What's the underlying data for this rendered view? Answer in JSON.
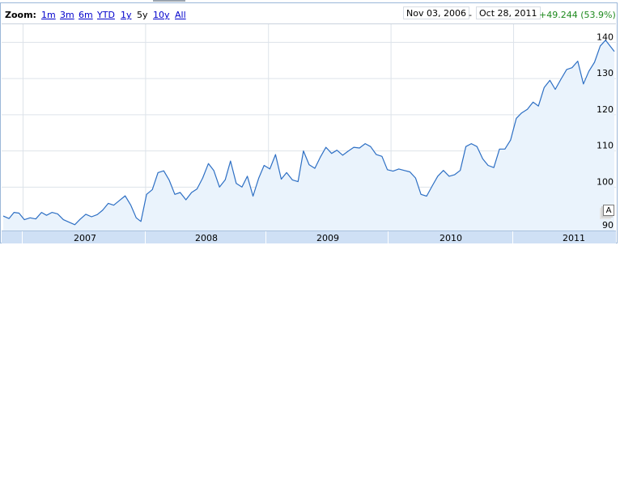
{
  "toolbar": {
    "zoom_label": "Zoom:",
    "zoom_options": [
      {
        "label": "1m",
        "selected": false
      },
      {
        "label": "3m",
        "selected": false
      },
      {
        "label": "6m",
        "selected": false
      },
      {
        "label": "YTD",
        "selected": false
      },
      {
        "label": "1y",
        "selected": false
      },
      {
        "label": "5y",
        "selected": true
      },
      {
        "label": "10y",
        "selected": false
      },
      {
        "label": "All",
        "selected": false
      }
    ],
    "start_date": "Nov 03, 2006",
    "separator": "-",
    "end_date": "Oct 28, 2011",
    "change": "+49.244 (53.9%)"
  },
  "annotation_flag": {
    "letter": "A"
  },
  "colors": {
    "line": "#2d6fc4",
    "fill": "#eaf3fc",
    "gain": "#1f8a1f",
    "link": "#0000cc",
    "timeline": "#cfe0f5"
  },
  "chart_data": {
    "type": "area",
    "title": "",
    "xlabel": "",
    "ylabel": "",
    "grid": true,
    "y_axis_side": "right",
    "y_ticks": [
      100,
      110,
      120,
      130,
      140
    ],
    "partial_bottom_tick": "90",
    "ylim": [
      88,
      145
    ],
    "xlim": [
      "2006-11-03",
      "2011-10-28"
    ],
    "x_ticks": [
      "2007-01-01",
      "2008-01-01",
      "2009-01-01",
      "2010-01-01",
      "2011-01-01"
    ],
    "timeline_labels": [
      "2007",
      "2008",
      "2009",
      "2010",
      "2011"
    ],
    "series": [
      {
        "points": [
          [
            "2006-11-03",
            92
          ],
          [
            "2006-11-20",
            91.3
          ],
          [
            "2006-12-05",
            93
          ],
          [
            "2006-12-20",
            92.8
          ],
          [
            "2007-01-05",
            91
          ],
          [
            "2007-01-22",
            91.5
          ],
          [
            "2007-02-08",
            91.2
          ],
          [
            "2007-02-25",
            93
          ],
          [
            "2007-03-12",
            92.2
          ],
          [
            "2007-03-28",
            93
          ],
          [
            "2007-04-14",
            92.6
          ],
          [
            "2007-05-01",
            91
          ],
          [
            "2007-05-18",
            90.3
          ],
          [
            "2007-06-04",
            89.6
          ],
          [
            "2007-06-20",
            91.1
          ],
          [
            "2007-07-07",
            92.5
          ],
          [
            "2007-07-24",
            91.8
          ],
          [
            "2007-08-10",
            92.4
          ],
          [
            "2007-08-26",
            93.6
          ],
          [
            "2007-09-12",
            95.5
          ],
          [
            "2007-09-28",
            95
          ],
          [
            "2007-10-15",
            96.3
          ],
          [
            "2007-11-01",
            97.6
          ],
          [
            "2007-11-18",
            95
          ],
          [
            "2007-12-04",
            91.5
          ],
          [
            "2007-12-18",
            90.5
          ],
          [
            "2008-01-04",
            98
          ],
          [
            "2008-01-21",
            99.3
          ],
          [
            "2008-02-07",
            104
          ],
          [
            "2008-02-24",
            104.5
          ],
          [
            "2008-03-11",
            102
          ],
          [
            "2008-03-28",
            98
          ],
          [
            "2008-04-13",
            98.5
          ],
          [
            "2008-04-30",
            96.5
          ],
          [
            "2008-05-17",
            98.5
          ],
          [
            "2008-06-02",
            99.5
          ],
          [
            "2008-06-19",
            102.5
          ],
          [
            "2008-07-06",
            106.5
          ],
          [
            "2008-07-22",
            104.6
          ],
          [
            "2008-08-08",
            100
          ],
          [
            "2008-08-25",
            102
          ],
          [
            "2008-09-10",
            107.2
          ],
          [
            "2008-09-27",
            101
          ],
          [
            "2008-10-14",
            100
          ],
          [
            "2008-10-30",
            103
          ],
          [
            "2008-11-16",
            97.5
          ],
          [
            "2008-12-03",
            102.5
          ],
          [
            "2008-12-19",
            106
          ],
          [
            "2009-01-05",
            105
          ],
          [
            "2009-01-22",
            109
          ],
          [
            "2009-02-08",
            102.2
          ],
          [
            "2009-02-24",
            104
          ],
          [
            "2009-03-13",
            102
          ],
          [
            "2009-03-30",
            101.5
          ],
          [
            "2009-04-15",
            110
          ],
          [
            "2009-05-02",
            106.2
          ],
          [
            "2009-05-19",
            105.2
          ],
          [
            "2009-06-04",
            108.2
          ],
          [
            "2009-06-21",
            111
          ],
          [
            "2009-07-08",
            109.3
          ],
          [
            "2009-07-24",
            110.2
          ],
          [
            "2009-08-10",
            108.8
          ],
          [
            "2009-08-27",
            110
          ],
          [
            "2009-09-12",
            111
          ],
          [
            "2009-09-29",
            110.8
          ],
          [
            "2009-10-16",
            112
          ],
          [
            "2009-11-01",
            111.2
          ],
          [
            "2009-11-18",
            109
          ],
          [
            "2009-12-05",
            108.5
          ],
          [
            "2009-12-21",
            104.8
          ],
          [
            "2010-01-07",
            104.4
          ],
          [
            "2010-01-24",
            105
          ],
          [
            "2010-02-09",
            104.6
          ],
          [
            "2010-02-26",
            104.2
          ],
          [
            "2010-03-15",
            102.5
          ],
          [
            "2010-03-31",
            98
          ],
          [
            "2010-04-17",
            97.5
          ],
          [
            "2010-05-04",
            100.4
          ],
          [
            "2010-05-20",
            103
          ],
          [
            "2010-06-06",
            104.6
          ],
          [
            "2010-06-23",
            103
          ],
          [
            "2010-07-09",
            103.4
          ],
          [
            "2010-07-26",
            104.6
          ],
          [
            "2010-08-12",
            111.2
          ],
          [
            "2010-08-28",
            112
          ],
          [
            "2010-09-14",
            111.2
          ],
          [
            "2010-10-01",
            107.8
          ],
          [
            "2010-10-17",
            106
          ],
          [
            "2010-11-03",
            105.4
          ],
          [
            "2010-11-20",
            110.5
          ],
          [
            "2010-12-06",
            110.5
          ],
          [
            "2010-12-23",
            113
          ],
          [
            "2011-01-09",
            119
          ],
          [
            "2011-01-25",
            120.5
          ],
          [
            "2011-02-11",
            121.5
          ],
          [
            "2011-02-28",
            123.5
          ],
          [
            "2011-03-16",
            122.4
          ],
          [
            "2011-04-02",
            127.5
          ],
          [
            "2011-04-19",
            129.5
          ],
          [
            "2011-05-05",
            127
          ],
          [
            "2011-05-22",
            129.8
          ],
          [
            "2011-06-08",
            132.5
          ],
          [
            "2011-06-24",
            133
          ],
          [
            "2011-07-11",
            134.8
          ],
          [
            "2011-07-28",
            128.5
          ],
          [
            "2011-08-13",
            132
          ],
          [
            "2011-08-30",
            134.5
          ],
          [
            "2011-09-16",
            139
          ],
          [
            "2011-10-02",
            140.6
          ],
          [
            "2011-10-28",
            137.5
          ]
        ]
      }
    ]
  }
}
